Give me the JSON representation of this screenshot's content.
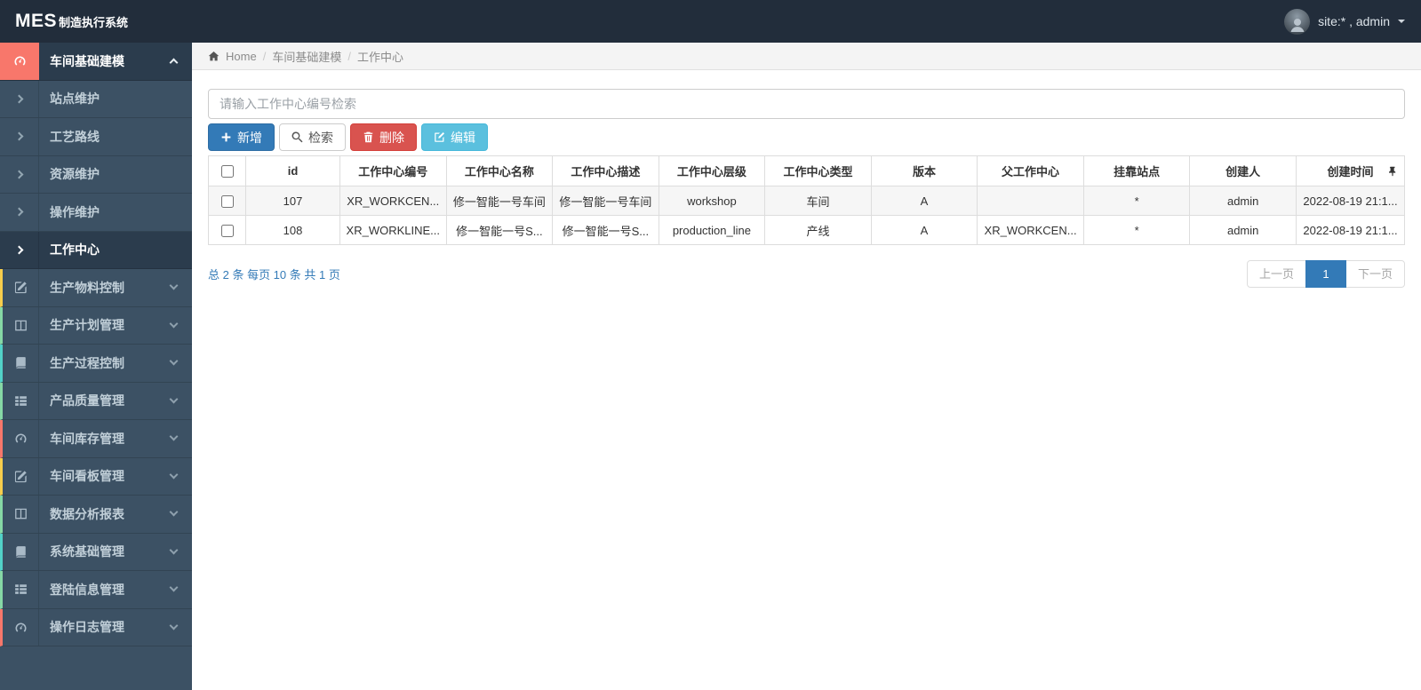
{
  "colors": {
    "topbar_bg": "#222d3b",
    "sidebar_bg": "#3c5164",
    "active_item_bg": "#2b3c4d",
    "primary_blue": "#337ab7",
    "danger_red": "#d9534f",
    "info_cyan": "#5bc0de",
    "accent_salmon": "#f8776b",
    "accent_yellow": "#f7cd4c",
    "accent_green": "#86d8a5",
    "accent_teal": "#52d2c8"
  },
  "navbar": {
    "brand_primary": "MES",
    "brand_secondary": "制造执行系统",
    "user_menu_label": "site:* , admin"
  },
  "sidebar": {
    "items": [
      {
        "label": "车间基础建模",
        "icon": "dashboard-icon",
        "accent": "#f8776b",
        "state": "expanded-active"
      },
      {
        "label": "站点维护",
        "icon": "chevron-right-icon"
      },
      {
        "label": "工艺路线",
        "icon": "chevron-right-icon"
      },
      {
        "label": "资源维护",
        "icon": "chevron-right-icon"
      },
      {
        "label": "操作维护",
        "icon": "chevron-right-icon"
      },
      {
        "label": "工作中心",
        "icon": "chevron-right-icon",
        "state": "active"
      },
      {
        "label": "生产物料控制",
        "icon": "pencil-icon",
        "accent": "#f7cd4c"
      },
      {
        "label": "生产计划管理",
        "icon": "columns-icon",
        "accent": "#86d8a5"
      },
      {
        "label": "生产过程控制",
        "icon": "book-icon",
        "accent": "#52d2c8"
      },
      {
        "label": "产品质量管理",
        "icon": "list-icon",
        "accent": "#86d8a5"
      },
      {
        "label": "车间库存管理",
        "icon": "dashboard-icon",
        "accent": "#f8776b"
      },
      {
        "label": "车间看板管理",
        "icon": "pencil-icon",
        "accent": "#f7cd4c"
      },
      {
        "label": "数据分析报表",
        "icon": "columns-icon",
        "accent": "#86d8a5"
      },
      {
        "label": "系统基础管理",
        "icon": "book-icon",
        "accent": "#52d2c8"
      },
      {
        "label": "登陆信息管理",
        "icon": "list-icon",
        "accent": "#86d8a5"
      },
      {
        "label": "操作日志管理",
        "icon": "dashboard-icon",
        "accent": "#f8776b"
      }
    ]
  },
  "breadcrumb": {
    "home_label": "Home",
    "sep": "/",
    "crumbs": [
      "车间基础建模",
      "工作中心"
    ]
  },
  "search": {
    "placeholder": "请输入工作中心编号检索",
    "value": ""
  },
  "toolbar": {
    "add_label": "新增",
    "search_label": "检索",
    "delete_label": "删除",
    "edit_label": "编辑"
  },
  "table": {
    "headers": [
      "id",
      "工作中心编号",
      "工作中心名称",
      "工作中心描述",
      "工作中心层级",
      "工作中心类型",
      "版本",
      "父工作中心",
      "挂靠站点",
      "创建人",
      "创建时间"
    ],
    "rows": [
      {
        "cells": [
          "107",
          "XR_WORKCEN...",
          "修一智能一号车间",
          "修一智能一号车间",
          "workshop",
          "车间",
          "A",
          "",
          "*",
          "admin",
          "2022-08-19 21:1..."
        ]
      },
      {
        "cells": [
          "108",
          "XR_WORKLINE...",
          "修一智能一号S...",
          "修一智能一号S...",
          "production_line",
          "产线",
          "A",
          "XR_WORKCEN...",
          "*",
          "admin",
          "2022-08-19 21:1..."
        ]
      }
    ]
  },
  "pagination": {
    "summary": "总 2 条 每页 10 条 共 1 页",
    "total_records": 2,
    "page_size": 10,
    "total_pages": 1,
    "prev_label": "上一页",
    "current_page": "1",
    "next_label": "下一页"
  }
}
